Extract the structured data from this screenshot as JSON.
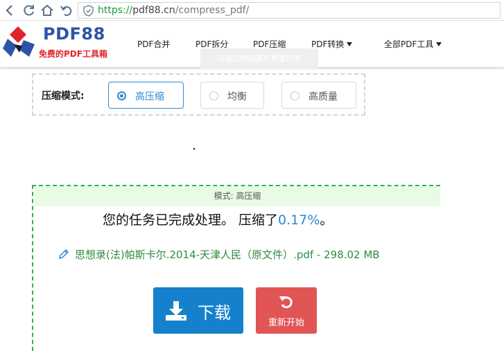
{
  "browser": {
    "url_scheme": "https://",
    "url_host": "pdf88.cn",
    "url_path": "/compress_pdf/"
  },
  "site": {
    "logo_text": "PDF88",
    "slogan": "免费的PDF工具箱",
    "menu": [
      {
        "label": "PDF合并"
      },
      {
        "label": "PDF拆分"
      },
      {
        "label": "PDF压缩"
      },
      {
        "label": "PDF转换"
      },
      {
        "label": "全部PDF工具"
      }
    ]
  },
  "tooltip": "压缩比例和图片质量均衡",
  "compress_mode": {
    "label": "压缩模式:",
    "options": [
      {
        "label": "高压缩",
        "selected": true
      },
      {
        "label": "均衡",
        "selected": false
      },
      {
        "label": "高质量",
        "selected": false
      }
    ]
  },
  "result": {
    "mode_text": "模式: 高压缩",
    "message_prefix": "您的任务已完成处理。 压缩了",
    "percent": "0.17%",
    "message_suffix": "。",
    "file_name": "思想录(法)帕斯卡尔.2014-天津人民（原文件）.pdf",
    "file_sep": " - ",
    "file_size": "298.02 MB",
    "download_label": "下载",
    "restart_label": "重新开始"
  },
  "colors": {
    "brand_blue": "#2f54a6",
    "brand_red": "#e0252a",
    "accent": "#2a8ad4",
    "success_green": "#2db34a",
    "download_bg": "#1581cc",
    "restart_bg": "#e25555"
  }
}
